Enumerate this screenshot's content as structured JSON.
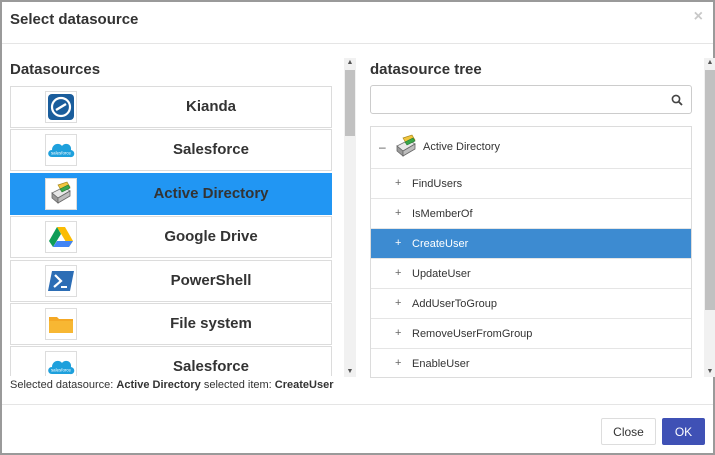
{
  "dialog": {
    "title": "Select datasource",
    "close_glyph": "×"
  },
  "left": {
    "heading": "Datasources",
    "items": [
      {
        "label": "Kianda",
        "icon": "kianda-icon",
        "selected": false
      },
      {
        "label": "Salesforce",
        "icon": "salesforce-icon",
        "selected": false
      },
      {
        "label": "Active Directory",
        "icon": "active-directory-icon",
        "selected": true
      },
      {
        "label": "Google Drive",
        "icon": "google-drive-icon",
        "selected": false
      },
      {
        "label": "PowerShell",
        "icon": "powershell-icon",
        "selected": false
      },
      {
        "label": "File system",
        "icon": "folder-icon",
        "selected": false
      },
      {
        "label": "Salesforce",
        "icon": "salesforce-icon",
        "selected": false
      }
    ]
  },
  "status": {
    "prefix": "Selected datasource:",
    "datasource": "Active Directory",
    "middle": "selected item:",
    "item": "CreateUser"
  },
  "right": {
    "heading": "datasource tree",
    "search": {
      "value": "",
      "placeholder": ""
    },
    "root": {
      "toggle": "–",
      "label": "Active Directory",
      "icon": "active-directory-icon"
    },
    "nodes": [
      {
        "label": "FindUsers",
        "selected": false
      },
      {
        "label": "IsMemberOf",
        "selected": false
      },
      {
        "label": "CreateUser",
        "selected": true
      },
      {
        "label": "UpdateUser",
        "selected": false
      },
      {
        "label": "AddUserToGroup",
        "selected": false
      },
      {
        "label": "RemoveUserFromGroup",
        "selected": false
      },
      {
        "label": "EnableUser",
        "selected": false
      }
    ],
    "plus_glyph": "+"
  },
  "footer": {
    "close_label": "Close",
    "ok_label": "OK"
  },
  "colors": {
    "selected_list": "#2196f3",
    "selected_tree": "#3d8bd1",
    "ok_button": "#3f51b5"
  }
}
